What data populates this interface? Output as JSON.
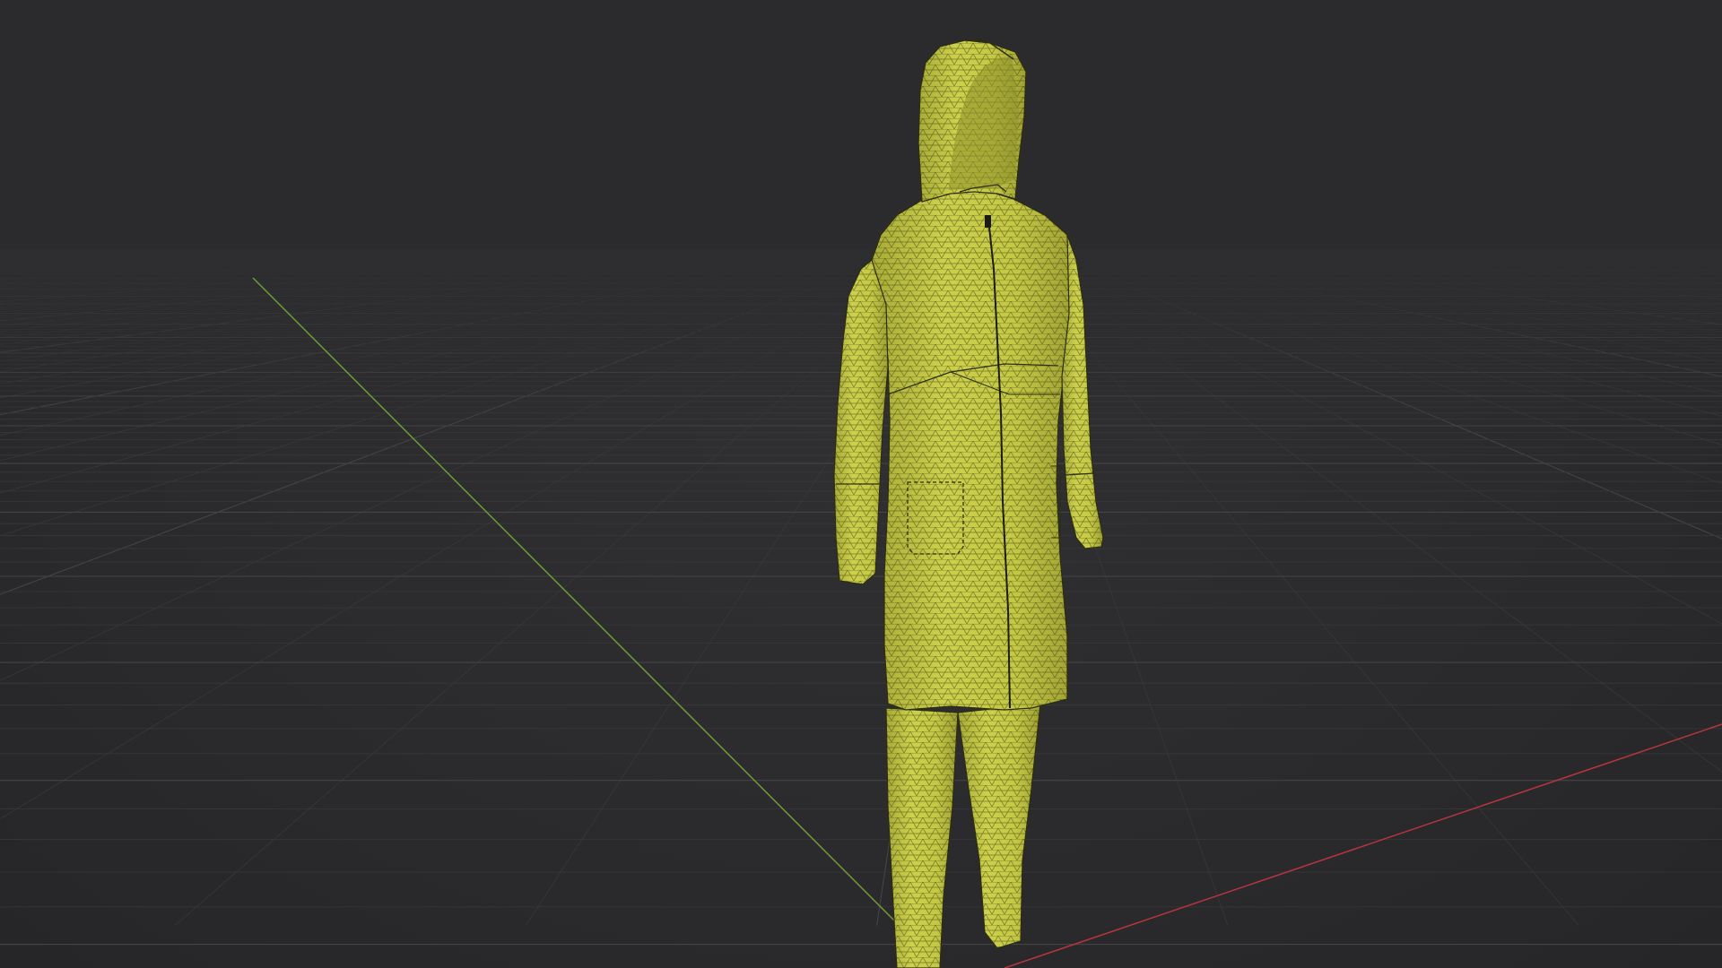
{
  "viewport": {
    "background_color": "#2b2b2d",
    "grid_minor_color": "#38383a",
    "grid_major_color": "#444447",
    "axis_x_color": "#b8353f",
    "axis_y_color": "#6f9a3a"
  },
  "model": {
    "name": "hooded-coat-with-pants",
    "mesh_display": "wireframe-on-shaded",
    "base_color": "#c9cc45",
    "shadow_color": "#9ea032",
    "wire_color": "#2c2e10"
  }
}
